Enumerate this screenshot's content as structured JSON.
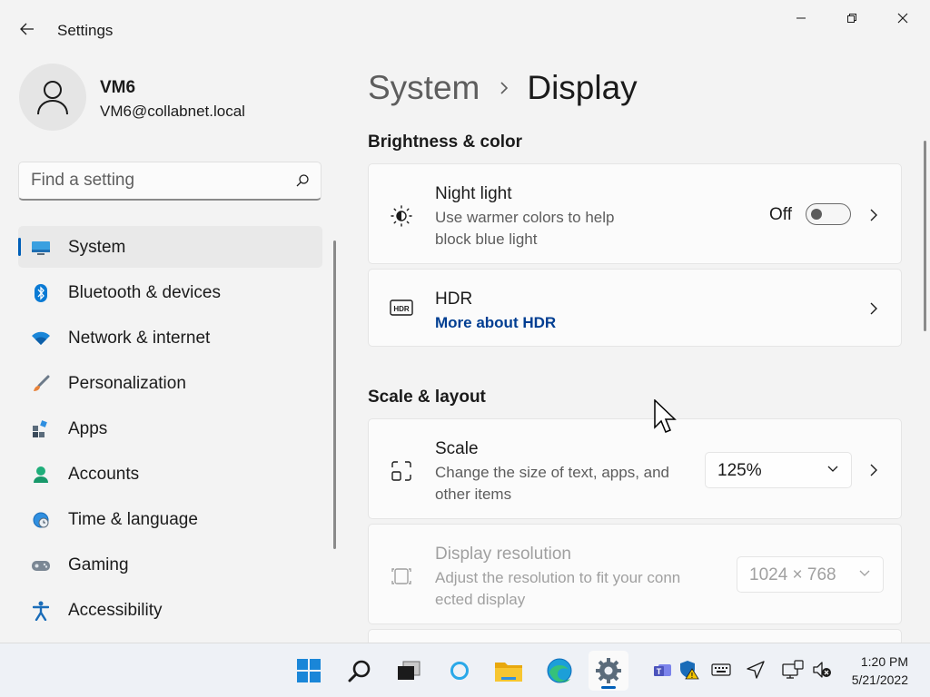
{
  "window": {
    "title": "Settings",
    "controls": [
      "minimize",
      "maximize",
      "close"
    ]
  },
  "user": {
    "name": "VM6",
    "email": "VM6@collabnet.local"
  },
  "search": {
    "placeholder": "Find a setting"
  },
  "sidebar": {
    "items": [
      {
        "label": "System",
        "icon": "monitor-icon",
        "selected": true
      },
      {
        "label": "Bluetooth & devices",
        "icon": "bluetooth-icon",
        "selected": false
      },
      {
        "label": "Network & internet",
        "icon": "wifi-icon",
        "selected": false
      },
      {
        "label": "Personalization",
        "icon": "brush-icon",
        "selected": false
      },
      {
        "label": "Apps",
        "icon": "apps-icon",
        "selected": false
      },
      {
        "label": "Accounts",
        "icon": "accounts-icon",
        "selected": false
      },
      {
        "label": "Time & language",
        "icon": "globe-clock-icon",
        "selected": false
      },
      {
        "label": "Gaming",
        "icon": "gamepad-icon",
        "selected": false
      },
      {
        "label": "Accessibility",
        "icon": "accessibility-icon",
        "selected": false
      }
    ]
  },
  "breadcrumb": {
    "parent": "System",
    "current": "Display"
  },
  "sections": {
    "brightness": {
      "title": "Brightness & color",
      "night_light": {
        "title": "Night light",
        "desc_line1": "Use warmer colors to help",
        "desc_line2": "block blue light",
        "state_label": "Off",
        "enabled": false
      },
      "hdr": {
        "title": "HDR",
        "link": "More about HDR"
      }
    },
    "scale_layout": {
      "title": "Scale & layout",
      "scale": {
        "title": "Scale",
        "desc_line1": "Change the size of text, apps, and",
        "desc_line2": "other items",
        "value": "125%"
      },
      "resolution": {
        "title": "Display resolution",
        "desc_line1": "Adjust the resolution to fit your conn",
        "desc_line2": "ected display",
        "value": "1024 × 768",
        "disabled": true
      }
    }
  },
  "taskbar": {
    "apps": [
      "start-icon",
      "search-icon",
      "task-view-icon",
      "cortana-icon",
      "file-explorer-icon",
      "edge-icon",
      "settings-icon"
    ],
    "active_app": "settings-icon",
    "tray": [
      "teams-icon",
      "security-warning-icon",
      "keyboard-icon",
      "location-icon",
      "network-icon",
      "volume-muted-icon"
    ],
    "time": "1:20 PM",
    "date": "5/21/2022"
  },
  "colors": {
    "accent": "#005fb8",
    "link": "#003e92",
    "window_bg": "#f3f3f3",
    "card_bg": "#fbfbfb"
  }
}
